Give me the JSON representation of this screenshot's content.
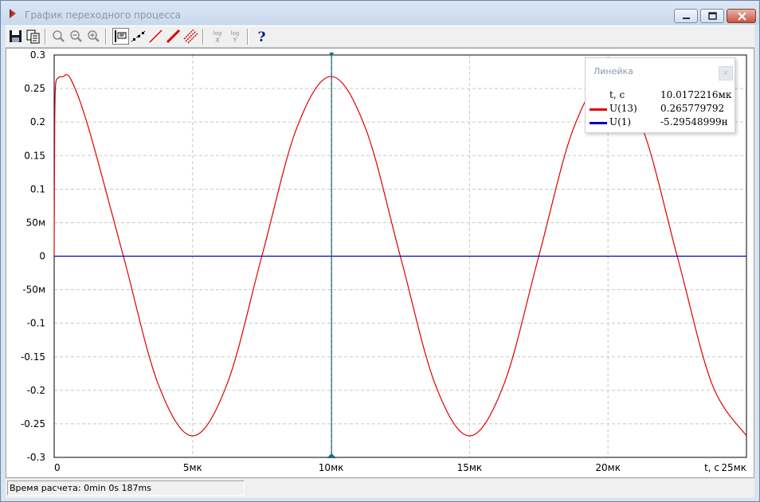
{
  "window": {
    "title": "График переходного процесса"
  },
  "toolbar": {
    "buttons": [
      {
        "name": "save",
        "icon": "save-icon"
      },
      {
        "name": "copy",
        "icon": "copy-icon"
      },
      {
        "name": "zoom-area",
        "icon": "zoom-area-icon"
      },
      {
        "name": "zoom-out",
        "icon": "zoom-out-icon"
      },
      {
        "name": "zoom-in",
        "icon": "zoom-in-icon"
      },
      {
        "name": "ruler",
        "icon": "ruler-icon",
        "pressed": true
      },
      {
        "name": "points",
        "icon": "points-icon"
      },
      {
        "name": "line-thin",
        "icon": "line-thin-icon"
      },
      {
        "name": "line-thick",
        "icon": "line-thick-icon"
      },
      {
        "name": "line-multi",
        "icon": "line-multi-icon"
      },
      {
        "name": "log-x",
        "icon": "log-x-icon",
        "top": "log",
        "bottom": "X"
      },
      {
        "name": "log-y",
        "icon": "log-y-icon",
        "top": "log",
        "bottom": "Y"
      },
      {
        "name": "help",
        "icon": "help-icon",
        "label": "?"
      }
    ]
  },
  "chart_data": {
    "type": "line",
    "xlabel": "t, с",
    "xlim": [
      0,
      25
    ],
    "ylim": [
      -0.3,
      0.3
    ],
    "x_ticks": [
      {
        "value": 0,
        "label": "0"
      },
      {
        "value": 5,
        "label": "5мк"
      },
      {
        "value": 10,
        "label": "10мк"
      },
      {
        "value": 15,
        "label": "15мк"
      },
      {
        "value": 20,
        "label": "20мк"
      },
      {
        "value": 25,
        "label": "25мк"
      }
    ],
    "y_ticks": [
      {
        "value": 0.3,
        "label": "0.3"
      },
      {
        "value": 0.25,
        "label": "0.25"
      },
      {
        "value": 0.2,
        "label": "0.2"
      },
      {
        "value": 0.15,
        "label": "0.15"
      },
      {
        "value": 0.1,
        "label": "0.1"
      },
      {
        "value": 0.05,
        "label": "50м"
      },
      {
        "value": 0,
        "label": "0"
      },
      {
        "value": -0.05,
        "label": "-50м"
      },
      {
        "value": -0.1,
        "label": "-0.1"
      },
      {
        "value": -0.15,
        "label": "-0.15"
      },
      {
        "value": -0.2,
        "label": "-0.2"
      },
      {
        "value": -0.25,
        "label": "-0.25"
      },
      {
        "value": -0.3,
        "label": "-0.3"
      }
    ],
    "grid": true,
    "cursor_x": 10.0172216,
    "series": [
      {
        "name": "U(13)",
        "color": "#e00000",
        "x": [
          0,
          0.01,
          0.02,
          0.05,
          0.15,
          0.3,
          0.6,
          1.25,
          2.5,
          3.75,
          5,
          6.25,
          7.5,
          8.75,
          10,
          11.25,
          12.5,
          13.75,
          15,
          16.25,
          17.5,
          18.75,
          20,
          21.25,
          22.5,
          23.75,
          25
        ],
        "y": [
          0,
          0.12,
          0.2,
          0.255,
          0.266,
          0.2675,
          0.264,
          0.19,
          0,
          -0.19,
          -0.268,
          -0.19,
          0,
          0.19,
          0.268,
          0.19,
          0,
          -0.19,
          -0.268,
          -0.19,
          0,
          0.19,
          0.268,
          0.19,
          0,
          -0.19,
          -0.268
        ]
      },
      {
        "name": "U(1)",
        "color": "#0000c0",
        "x": [
          0,
          25
        ],
        "y": [
          0,
          0
        ]
      }
    ]
  },
  "ruler": {
    "title": "Линейка",
    "close_label": "×",
    "rows": [
      {
        "label": "t, с",
        "value": "10.0172216мк",
        "color": ""
      },
      {
        "label": "U(13)",
        "value": "0.265779792",
        "color": "#e00000"
      },
      {
        "label": "U(1)",
        "value": "-5.29548999н",
        "color": "#0000c0"
      }
    ]
  },
  "status": {
    "text": "Время расчета: 0min 0s 187ms"
  }
}
